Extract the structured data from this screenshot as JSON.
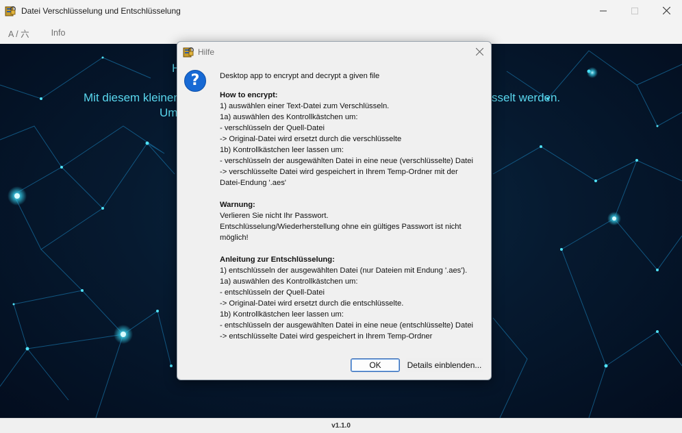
{
  "window": {
    "title": "Datei Verschlüsselung und Entschlüsselung",
    "minimize_icon": "minimize-icon",
    "maximize_icon": "maximize-icon",
    "close_icon": "close-icon"
  },
  "menu": {
    "items": [
      "A / 六",
      "Info"
    ]
  },
  "background": {
    "line1": "H",
    "line2_left": "Mit diesem kleinen",
    "line2_right": "sselt werden.",
    "line3": "Um"
  },
  "statusbar": {
    "version": "v1.1.0"
  },
  "dialog": {
    "title": "Hilfe",
    "icon": "question-icon",
    "intro": "Desktop app to encrypt and decrypt a given file",
    "lines": [
      {
        "text": "How to encrypt:",
        "bold": true
      },
      {
        "text": "1) auswählen einer Text-Datei zum Verschlüsseln.",
        "bold": false
      },
      {
        "text": "1a) auswählen des Kontrollkästchen um:",
        "bold": false
      },
      {
        "text": "- verschlüsseln der Quell-Datei",
        "bold": false
      },
      {
        "text": "-> Original-Datei wird ersetzt durch die verschlüsselte",
        "bold": false
      },
      {
        "text": "1b) Kontrollkästchen leer lassen um:",
        "bold": false
      },
      {
        "text": "- verschlüsseln der ausgewählten Datei in eine neue (verschlüsselte) Datei",
        "bold": false
      },
      {
        "text": "-> verschlüsselte Datei wird gespeichert in Ihrem Temp-Ordner mit der",
        "bold": false
      },
      {
        "text": "Datei-Endung '.aes'",
        "bold": false
      },
      {
        "text": "",
        "bold": false
      },
      {
        "text": "Warnung:",
        "bold": true
      },
      {
        "text": "Verlieren Sie nicht Ihr Passwort.",
        "bold": false
      },
      {
        "text": "Entschlüsselung/Wiederherstellung ohne ein gültiges Passwort ist nicht",
        "bold": false
      },
      {
        "text": "möglich!",
        "bold": false
      },
      {
        "text": "",
        "bold": false
      },
      {
        "text": "Anleitung zur Entschlüsselung:",
        "bold": true
      },
      {
        "text": "1) entschlüsseln der ausgewählten Datei (nur Dateien mit Endung '.aes').",
        "bold": false
      },
      {
        "text": "1a) auswählen des Kontrollkästchen um:",
        "bold": false
      },
      {
        "text": "- entschlüsseln der Quell-Datei",
        "bold": false
      },
      {
        "text": "-> Original-Datei wird ersetzt durch die entschlüsselte.",
        "bold": false
      },
      {
        "text": "1b) Kontrollkästchen leer lassen um:",
        "bold": false
      },
      {
        "text": "- entschlüsseln der ausgewählten Datei in eine neue (entschlüsselte) Datei",
        "bold": false
      },
      {
        "text": "-> entschlüsselte Datei wird gespeichert in Ihrem Temp-Ordner",
        "bold": false
      }
    ],
    "ok_label": "OK",
    "details_label": "Details einblenden..."
  }
}
